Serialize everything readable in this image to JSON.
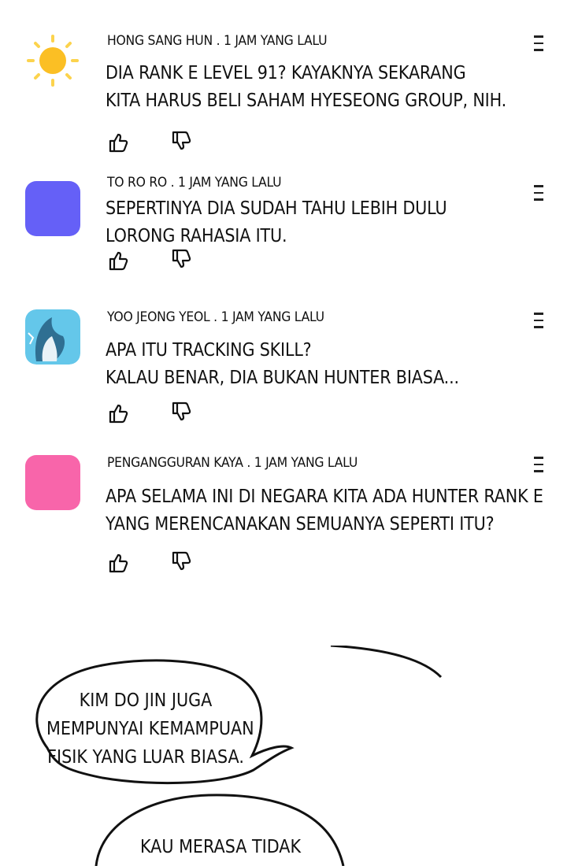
{
  "comments": [
    {
      "meta": "HONG SANG HUN . 1 JAM YANG LALU",
      "avatar": "sun-avatar",
      "lines": [
        "DIA RANK E LEVEL 91? KAYAKNYA SEKARANG",
        "KITA HARUS BELI SAHAM HYESEONG GROUP, NIH."
      ]
    },
    {
      "meta": "TO RO RO . 1 JAM YANG LALU",
      "avatar_color": "#6560f7",
      "lines": [
        "SEPERTINYA DIA SUDAH TAHU LEBIH DULU",
        "LORONG RAHASIA ITU."
      ]
    },
    {
      "meta": "YOO JEONG YEOL . 1 JAM YANG LALU",
      "avatar": "whale-avatar",
      "lines": [
        "APA ITU TRACKING SKILL?",
        "KALAU BENAR, DIA BUKAN HUNTER BIASA..."
      ]
    },
    {
      "meta": "PENGANGGURAN KAYA . 1 JAM YANG LALU",
      "avatar_color": "#f865aa",
      "lines": [
        "APA SELAMA INI DI NEGARA KITA ADA HUNTER RANK E",
        "YANG MERENCANAKAN SEMUANYA SEPERTI ITU?"
      ]
    }
  ],
  "icons": {
    "like": "thumbs-up-icon",
    "dislike": "thumbs-down-icon",
    "menu": "more-menu-icon"
  },
  "speech": {
    "bubble1": [
      "KIM DO JIN JUGA",
      "MEMPUNYAI KEMAMPUAN",
      "FISIK YANG LUAR BIASA."
    ],
    "bubble2": [
      "KAU MERASA TIDAK"
    ]
  }
}
